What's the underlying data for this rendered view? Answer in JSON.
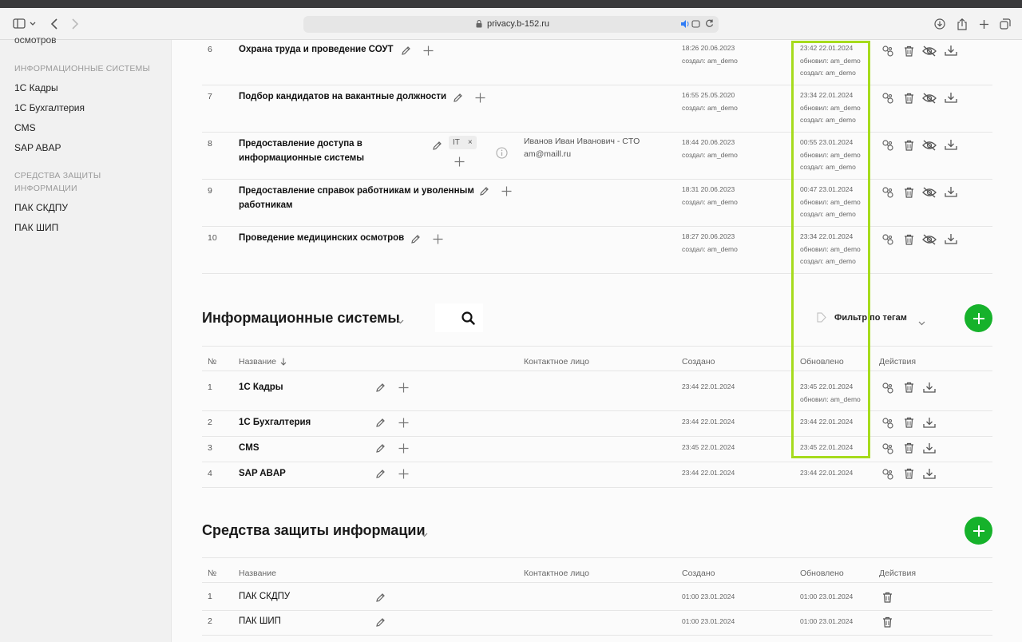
{
  "browser": {
    "url": "privacy.b-152.ru"
  },
  "sidebar": {
    "cut_item": "осмотров",
    "section_is": "ИНФОРМАЦИОННЫЕ СИСТЕМЫ",
    "is_items": [
      "1С Кадры",
      "1С Бухгалтерия",
      "CMS",
      "SAP ABAP"
    ],
    "section_szi_line1": "СРЕДСТВА ЗАЩИТЫ",
    "section_szi_line2": "ИНФОРМАЦИИ",
    "szi_items": [
      "ПАК СКДПУ",
      "ПАК ШИП"
    ]
  },
  "processes": {
    "rows": [
      {
        "num": "6",
        "name_line1": "Охрана труда и проведение СОУТ",
        "name_line2": "",
        "created_time": "18:26 20.06.2023",
        "created_by": "создал: am_demo",
        "updated_time": "23:42 22.01.2024",
        "updated_by": "обновил: am_demo",
        "created_by2": "создал: am_demo"
      },
      {
        "num": "7",
        "name_line1": "Подбор кандидатов на вакантные должности",
        "name_line2": "",
        "created_time": "16:55 25.05.2020",
        "created_by": "создал: am_demo",
        "updated_time": "23:34 22.01.2024",
        "updated_by": "обновил: am_demo",
        "created_by2": "создал: am_demo"
      },
      {
        "num": "8",
        "name_line1": "Предоставление доступа в",
        "name_line2": "информационные системы",
        "created_time": "18:44 20.06.2023",
        "created_by": "создал: am_demo",
        "updated_time": "00:55 23.01.2024",
        "updated_by": "обновил: am_demo",
        "created_by2": "создал: am_demo",
        "tag": "IT",
        "tag_close": "×",
        "contact_name": "Иванов Иван Иванович - CTO",
        "contact_email": "am@maill.ru"
      },
      {
        "num": "9",
        "name_line1": "Предоставление справок работникам и уволенным",
        "name_line2": "работникам",
        "created_time": "18:31 20.06.2023",
        "created_by": "создал: am_demo",
        "updated_time": "00:47 23.01.2024",
        "updated_by": "обновил: am_demo",
        "created_by2": "создал: am_demo"
      },
      {
        "num": "10",
        "name_line1": "Проведение медицинских осмотров",
        "name_line2": "",
        "created_time": "18:27 20.06.2023",
        "created_by": "создал: am_demo",
        "updated_time": "23:34 22.01.2024",
        "updated_by": "обновил: am_demo",
        "created_by2": "создал: am_demo"
      }
    ]
  },
  "is_section": {
    "title": "Информационные системы",
    "filter_label": "Фильтр по тегам",
    "headers": {
      "num": "№",
      "name": "Название",
      "contact": "Контактное лицо",
      "created": "Создано",
      "updated": "Обновлено",
      "actions": "Действия"
    },
    "rows": [
      {
        "num": "1",
        "name": "1С Кадры",
        "created": "23:44 22.01.2024",
        "updated": "23:45 22.01.2024",
        "updated_by": "обновил: am_demo"
      },
      {
        "num": "2",
        "name": "1С Бухгалтерия",
        "created": "23:44 22.01.2024",
        "updated": "23:44 22.01.2024",
        "updated_by": ""
      },
      {
        "num": "3",
        "name": "CMS",
        "created": "23:45 22.01.2024",
        "updated": "23:45 22.01.2024",
        "updated_by": ""
      },
      {
        "num": "4",
        "name": "SAP ABAP",
        "created": "23:44 22.01.2024",
        "updated": "23:44 22.01.2024",
        "updated_by": ""
      }
    ]
  },
  "szi_section": {
    "title": "Средства защиты информации",
    "headers": {
      "num": "№",
      "name": "Название",
      "contact": "Контактное лицо",
      "created": "Создано",
      "updated": "Обновлено",
      "actions": "Действия"
    },
    "rows": [
      {
        "num": "1",
        "name": "ПАК СКДПУ",
        "created": "01:00 23.01.2024",
        "updated": "01:00 23.01.2024"
      },
      {
        "num": "2",
        "name": "ПАК ШИП",
        "created": "01:00 23.01.2024",
        "updated": "01:00 23.01.2024"
      }
    ]
  },
  "colors": {
    "accent_green": "#16b22b",
    "highlight": "#a6db1c"
  }
}
